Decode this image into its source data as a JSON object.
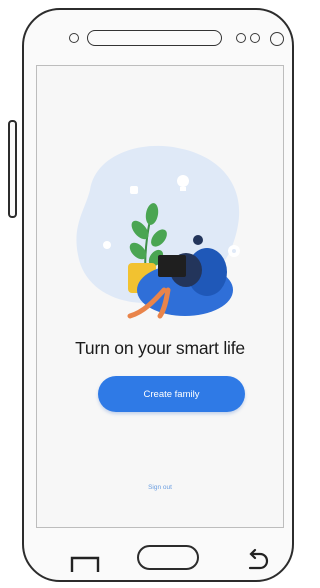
{
  "screen": {
    "headline": "Turn on your smart life",
    "create_button": "Create family",
    "secondary_link": "Sign out"
  },
  "colors": {
    "accent": "#2f7ae6",
    "blob": "#dfe9f7",
    "plant": "#4aa552",
    "pot": "#f2c230",
    "beanbag": "#2f6fd8",
    "person_skin": "#e9844a"
  },
  "icons": [
    "lightbulb-icon",
    "plant-icon",
    "laptop-icon",
    "back-nav-icon",
    "home-button",
    "recent-apps-icon"
  ]
}
